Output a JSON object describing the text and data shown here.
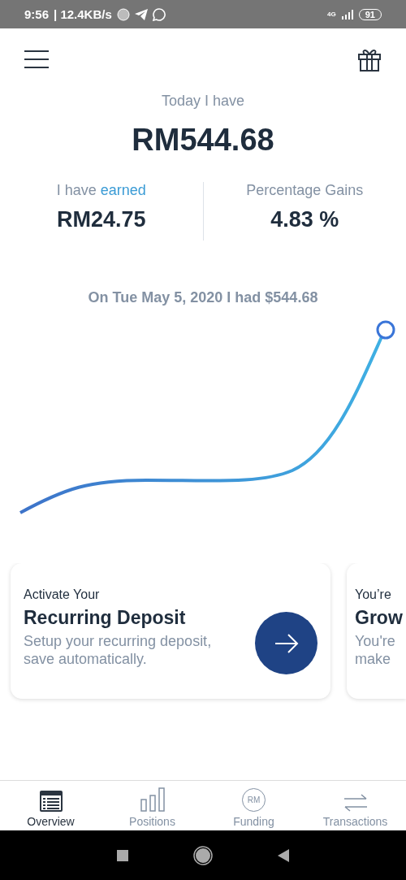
{
  "status_bar": {
    "time": "9:56",
    "speed": "| 12.4KB/s",
    "network": "4G",
    "battery": "91"
  },
  "summary": {
    "title": "Today I have",
    "amount": "RM544.68"
  },
  "stats": [
    {
      "label_prefix": "I have ",
      "label_highlight": "earned",
      "value": "RM24.75"
    },
    {
      "label_prefix": "Percentage Gains",
      "value": "4.83 %"
    }
  ],
  "chart": {
    "caption": "On Tue May 5, 2020 I had $544.68"
  },
  "cards": [
    {
      "overline": "Activate Your",
      "title": "Recurring Deposit",
      "body": "Setup your recurring deposit, save automatically."
    },
    {
      "overline": "You’re",
      "title": "Grow",
      "body": "You're make"
    }
  ],
  "tabs": [
    {
      "label": "Overview",
      "selected": true
    },
    {
      "label": "Positions",
      "selected": false
    },
    {
      "label": "Funding",
      "icon_text": "RM",
      "selected": false
    },
    {
      "label": "Transactions",
      "selected": false
    }
  ]
}
